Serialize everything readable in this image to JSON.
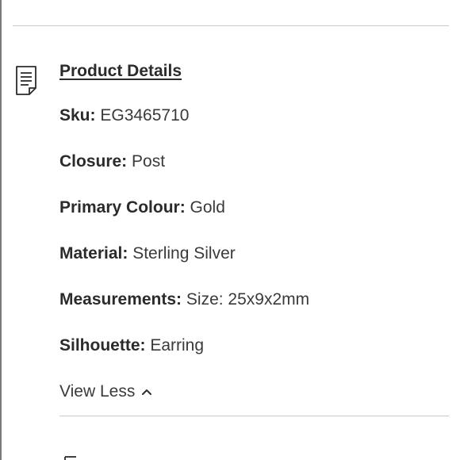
{
  "section": {
    "title": "Product Details",
    "icon": "document-icon"
  },
  "details": [
    {
      "label": "Sku:",
      "value": "EG3465710"
    },
    {
      "label": "Closure:",
      "value": "Post"
    },
    {
      "label": "Primary Colour:",
      "value": "Gold"
    },
    {
      "label": "Material:",
      "value": "Sterling Silver"
    },
    {
      "label": "Measurements:",
      "value": "Size: 25x9x2mm"
    },
    {
      "label": "Silhouette:",
      "value": "Earring"
    }
  ],
  "toggle": {
    "label": "View Less",
    "icon": "chevron-up-icon"
  }
}
